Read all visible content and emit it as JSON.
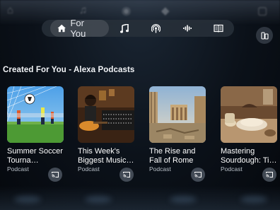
{
  "nav": {
    "for_you_label": "For You",
    "items": [
      "music-icon",
      "podcast-icon",
      "audiobook-icon",
      "library-icon"
    ]
  },
  "section": {
    "title": "Created For You - Alexa Podcasts"
  },
  "cards": [
    {
      "title": "Summer Soccer Tourna…",
      "type": "Podcast"
    },
    {
      "title": "This Week's Biggest Music…",
      "type": "Podcast"
    },
    {
      "title": "The Rise and Fall of Rome",
      "type": "Podcast"
    },
    {
      "title": "Mastering Sourdough: Ti…",
      "type": "Podcast"
    }
  ],
  "colors": {
    "accent": "#ffffff",
    "nav_bg": "#28303a",
    "card_sub": "#b9c0c8"
  }
}
